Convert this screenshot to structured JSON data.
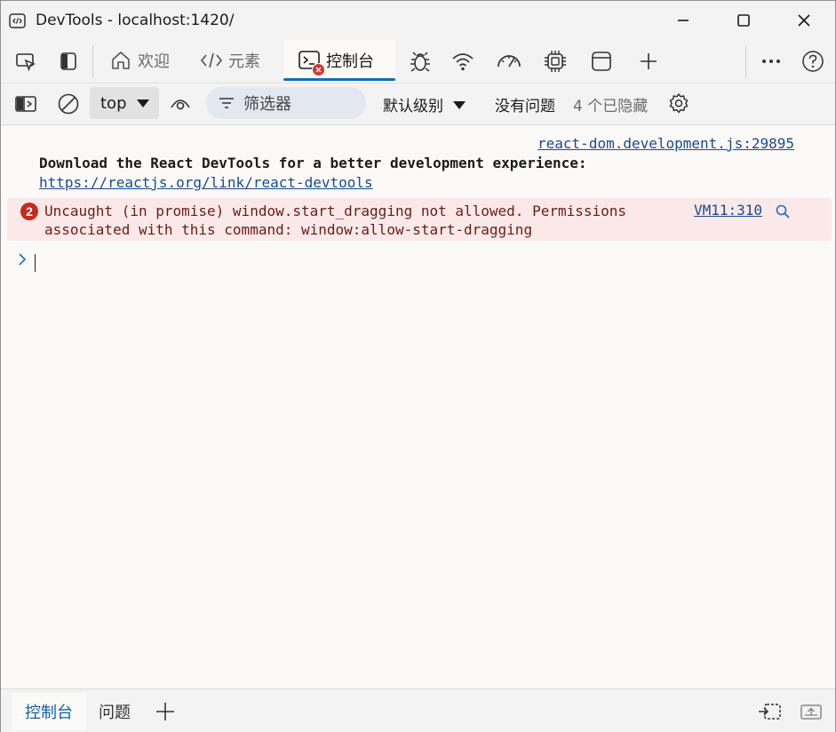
{
  "window": {
    "title": "DevTools - localhost:1420/"
  },
  "tabs": [
    {
      "label": "欢迎",
      "icon": "home-icon"
    },
    {
      "label": "元素",
      "icon": "code-icon"
    },
    {
      "label": "控制台",
      "icon": "console-icon",
      "active": true
    }
  ],
  "toolbar": {
    "context": "top",
    "filter_placeholder": "筛选器",
    "levels": "默认级别",
    "issues": "没有问题",
    "hidden": "4 个已隐藏"
  },
  "console": {
    "entries": [
      {
        "source": "react-dom.development.js:29895",
        "text": "Download the React DevTools for a better development experience:",
        "link": "https://reactjs.org/link/react-devtools"
      },
      {
        "level": "error",
        "count": "2",
        "text": "Uncaught (in promise) window.start_dragging not allowed. Permissions associated with this command: window:allow-start-dragging",
        "source": "VM11:310"
      }
    ]
  },
  "drawer": {
    "tabs": [
      "控制台",
      "问题"
    ]
  },
  "colors": {
    "accent": "#0f6cbd",
    "error_bg": "#fbe9e9",
    "error_badge": "#c42b1c",
    "link": "#1a4a8e"
  }
}
